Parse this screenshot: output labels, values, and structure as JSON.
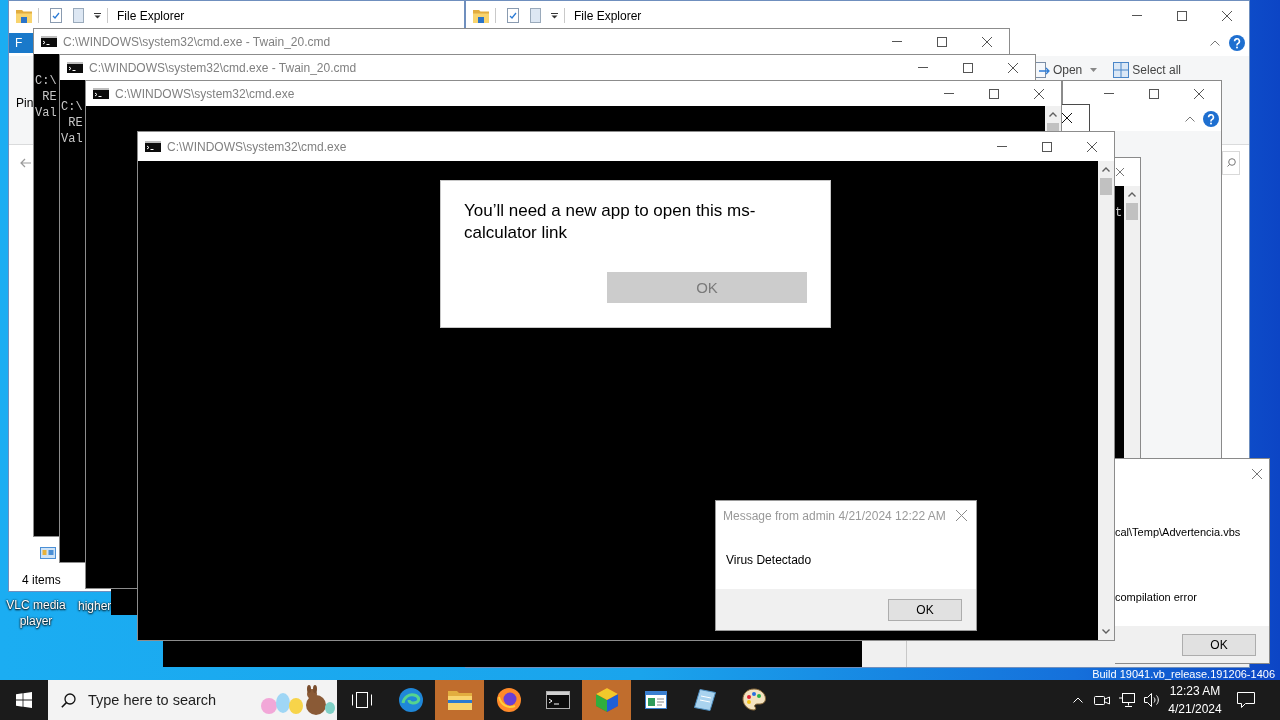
{
  "desktop": {
    "icons": [
      {
        "label": "VLC media player"
      },
      {
        "label": "higher"
      }
    ],
    "build_text": "Build 19041.vb_release.191206-1406"
  },
  "explorer_left": {
    "title": "File Explorer",
    "file_tab": "F",
    "ribbon_text": "Pin",
    "status": "4 items"
  },
  "explorer_right": {
    "title": "File Explorer",
    "ribbon_buttons": [
      {
        "label": "Open",
        "dropdown": true
      },
      {
        "label": "Select all",
        "dropdown": false
      }
    ]
  },
  "consoles": [
    {
      "title": "C:\\WINDOWS\\system32\\cmd.exe - Twain_20.cmd",
      "lines": [
        "C:\\",
        " RE",
        "Val"
      ]
    },
    {
      "title": "C:\\WINDOWS\\system32\\cmd.exe - Twain_20.cmd",
      "lines": [
        "C:\\",
        " RE",
        "Val"
      ]
    },
    {
      "title": "C:\\WINDOWS\\system32\\cmd.exe"
    },
    {
      "title": "C:\\WINDOWS\\system32\\cmd.exe"
    }
  ],
  "back_console": {
    "lines": [
      "t"
    ]
  },
  "app_prompt": {
    "message": "You’ll need a new app to open this ms-calculator link",
    "button": {
      "label": "OK",
      "disabled": true
    }
  },
  "message_box": {
    "title": "Message from admin 4/21/2024 12:22 AM",
    "message": "Virus Detectado",
    "button": "OK"
  },
  "script_error": {
    "lines": [
      "cal\\Temp\\Advertencia.vbs",
      "compilation error"
    ],
    "button": "OK"
  },
  "taskbar": {
    "search": {
      "placeholder": "Type here to search"
    },
    "apps": [
      {
        "kind": "taskview",
        "highlighted": false
      },
      {
        "kind": "browser",
        "highlighted": false
      },
      {
        "kind": "folder",
        "highlighted": true
      },
      {
        "kind": "fox",
        "highlighted": false
      },
      {
        "kind": "console",
        "highlighted": false
      },
      {
        "kind": "cube",
        "highlighted": true
      },
      {
        "kind": "window",
        "highlighted": false
      },
      {
        "kind": "notebook",
        "highlighted": false
      },
      {
        "kind": "palette",
        "highlighted": false
      }
    ],
    "clock": {
      "time": "12:23 AM",
      "date": "4/21/2024"
    }
  }
}
